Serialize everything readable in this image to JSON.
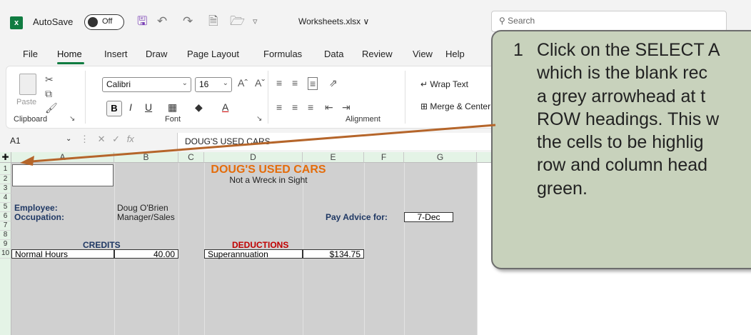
{
  "titlebar": {
    "autosave_label": "AutoSave",
    "toggle_state": "Off",
    "filename": "Worksheets.xlsx ∨",
    "search_placeholder": "Search"
  },
  "menu": {
    "tabs": [
      "File",
      "Home",
      "Insert",
      "Draw",
      "Page Layout",
      "Formulas",
      "Data",
      "Review",
      "View",
      "Help"
    ],
    "active": "Home"
  },
  "ribbon": {
    "clipboard": {
      "paste": "Paste",
      "label": "Clipboard"
    },
    "font": {
      "name": "Calibri",
      "size": "16",
      "label": "Font"
    },
    "alignment": {
      "wrap_text": "Wrap Text",
      "merge_center": "Merge & Center",
      "label": "Alignment"
    }
  },
  "formula_bar": {
    "name_box": "A1",
    "fx": "fx",
    "content": "DOUG'S USED CARS"
  },
  "grid": {
    "select_all_icon": "plus-cursor-icon",
    "columns": [
      "A",
      "B",
      "C",
      "D",
      "E",
      "F",
      "G"
    ],
    "rows": [
      "1",
      "2",
      "3",
      "4",
      "5",
      "6",
      "7",
      "8",
      "9",
      "10"
    ],
    "title": "DOUG'S USED CARS",
    "subtitle": "Not a Wreck in Sight",
    "employee_label": "Employee:",
    "employee_value": "Doug O'Brien",
    "occupation_label": "Occupation:",
    "occupation_value": "Manager/Sales",
    "pay_advice_label": "Pay Advice for:",
    "pay_advice_value": "7-Dec",
    "credits": "CREDITS",
    "deductions": "DEDUCTIONS",
    "normal_hours_label": "Normal Hours",
    "normal_hours_value": "40.00",
    "superannuation_label": "Superannuation",
    "superannuation_value": "$134.75"
  },
  "callout": {
    "number": "1",
    "text": "Click on the SELECT A\nwhich is the blank rec\na grey arrowhead at t\nROW headings. This w\nthe cells to be highlig\nrow and column head\ngreen."
  },
  "colors": {
    "excel_green": "#107c41",
    "title_orange": "#e46c0a",
    "callout_bg": "#c8d2bc",
    "arrow": "#b5652a"
  }
}
